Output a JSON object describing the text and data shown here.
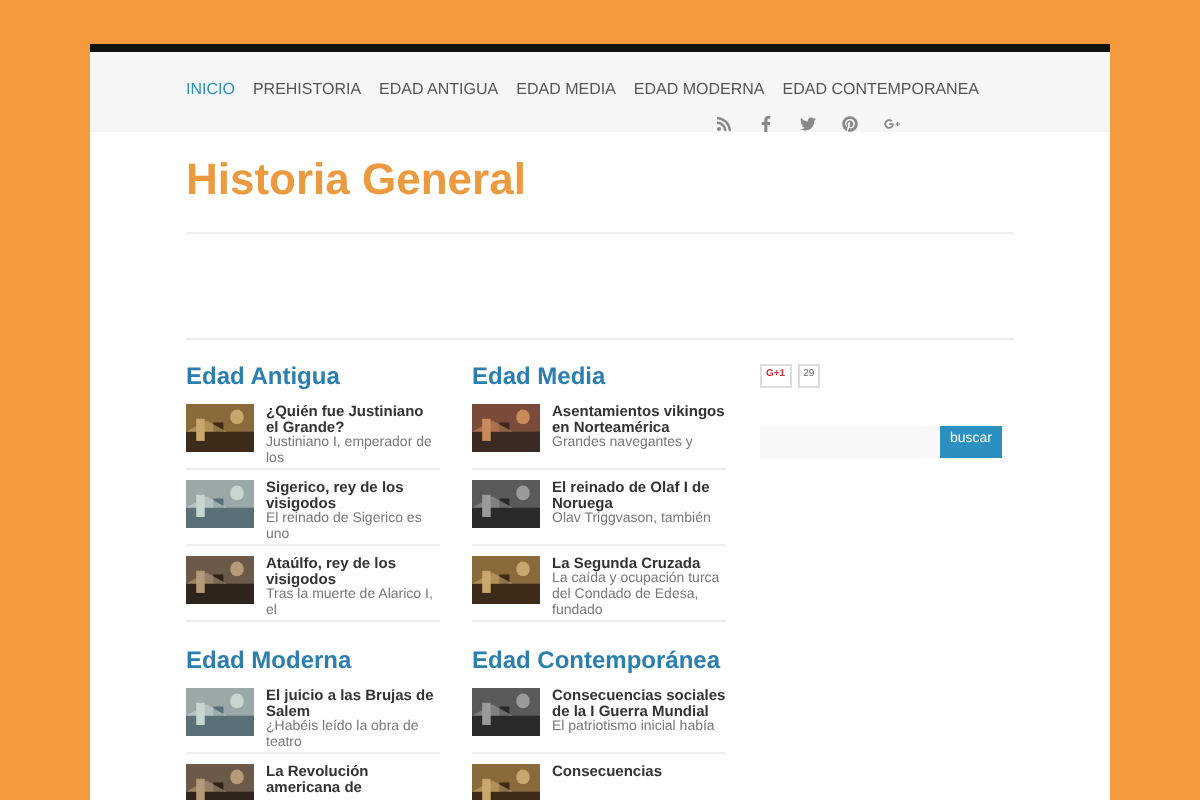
{
  "nav": {
    "items": [
      {
        "label": "INICIO",
        "selected": true
      },
      {
        "label": "PREHISTORIA",
        "selected": false
      },
      {
        "label": "EDAD ANTIGUA",
        "selected": false
      },
      {
        "label": "EDAD MEDIA",
        "selected": false
      },
      {
        "label": "EDAD MODERNA",
        "selected": false
      },
      {
        "label": "EDAD CONTEMPORANEA",
        "selected": false
      }
    ]
  },
  "site_title": "Historia General",
  "sections": [
    {
      "heading": "Edad Antigua",
      "posts": [
        {
          "title": "¿Quién fue Justiniano el Grande?",
          "excerpt": "Justiniano I, emperador de los"
        },
        {
          "title": "Sigerico, rey de los visigodos",
          "excerpt": "El reinado de Sigerico es uno"
        },
        {
          "title": "Ataúlfo, rey de los visigodos",
          "excerpt": "Tras la muerte de Alarico I, el"
        }
      ]
    },
    {
      "heading": "Edad Media",
      "posts": [
        {
          "title": "Asentamientos vikingos en Norteamérica",
          "excerpt": "Grandes navegantes y"
        },
        {
          "title": "El reinado de Olaf I de Noruega",
          "excerpt": "Olav Triggvason, también"
        },
        {
          "title": "La Segunda Cruzada",
          "excerpt": "La caída y ocupación turca del Condado de Edesa, fundado"
        }
      ]
    },
    {
      "heading": "Edad Moderna",
      "posts": [
        {
          "title": "El juicio a las Brujas de Salem",
          "excerpt": "¿Habéis leído la obra de teatro"
        },
        {
          "title": "La Revolución americana de"
        }
      ]
    },
    {
      "heading": "Edad Contemporánea",
      "posts": [
        {
          "title": "Consecuencias sociales de la I Guerra Mundial",
          "excerpt": "El patriotismo inicial había"
        },
        {
          "title": "Consecuencias"
        }
      ]
    }
  ],
  "sidebar": {
    "plus_one": {
      "label": "G+1",
      "count": "29"
    },
    "search_button": "buscar"
  }
}
